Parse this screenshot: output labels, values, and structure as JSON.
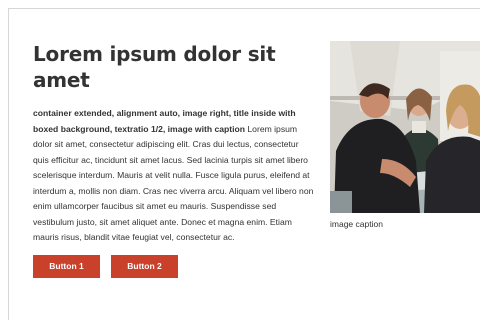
{
  "section": {
    "title": "Lorem ipsum dolor sit amet",
    "body_lead": "container extended, alignment auto, image right, title inside with boxed background, textratio 1/2, image with caption",
    "body_text": " Lorem ipsum dolor sit amet, consectetur adipiscing elit. Cras dui lectus, consectetur quis efficitur ac, tincidunt sit amet lacus. Sed lacinia turpis sit amet libero scelerisque interdum. Mauris at velit nulla. Fusce ligula purus, eleifend at interdum a, mollis non diam. Cras nec viverra arcu. Aliquam vel libero non enim ullamcorper faucibus sit amet eu mauris. Suspendisse sed vestibulum justo, sit amet aliquet ante. Donec et magna enim. Etiam mauris risus, blandit vitae feugiat vel, consectetur ac.",
    "buttons": [
      {
        "label": "Button 1"
      },
      {
        "label": "Button 2"
      }
    ],
    "image": {
      "caption": "image caption"
    }
  },
  "colors": {
    "button_bg": "#c9402b",
    "button_text": "#ffffff",
    "text": "#333333",
    "rule": "#d6d6d6"
  }
}
